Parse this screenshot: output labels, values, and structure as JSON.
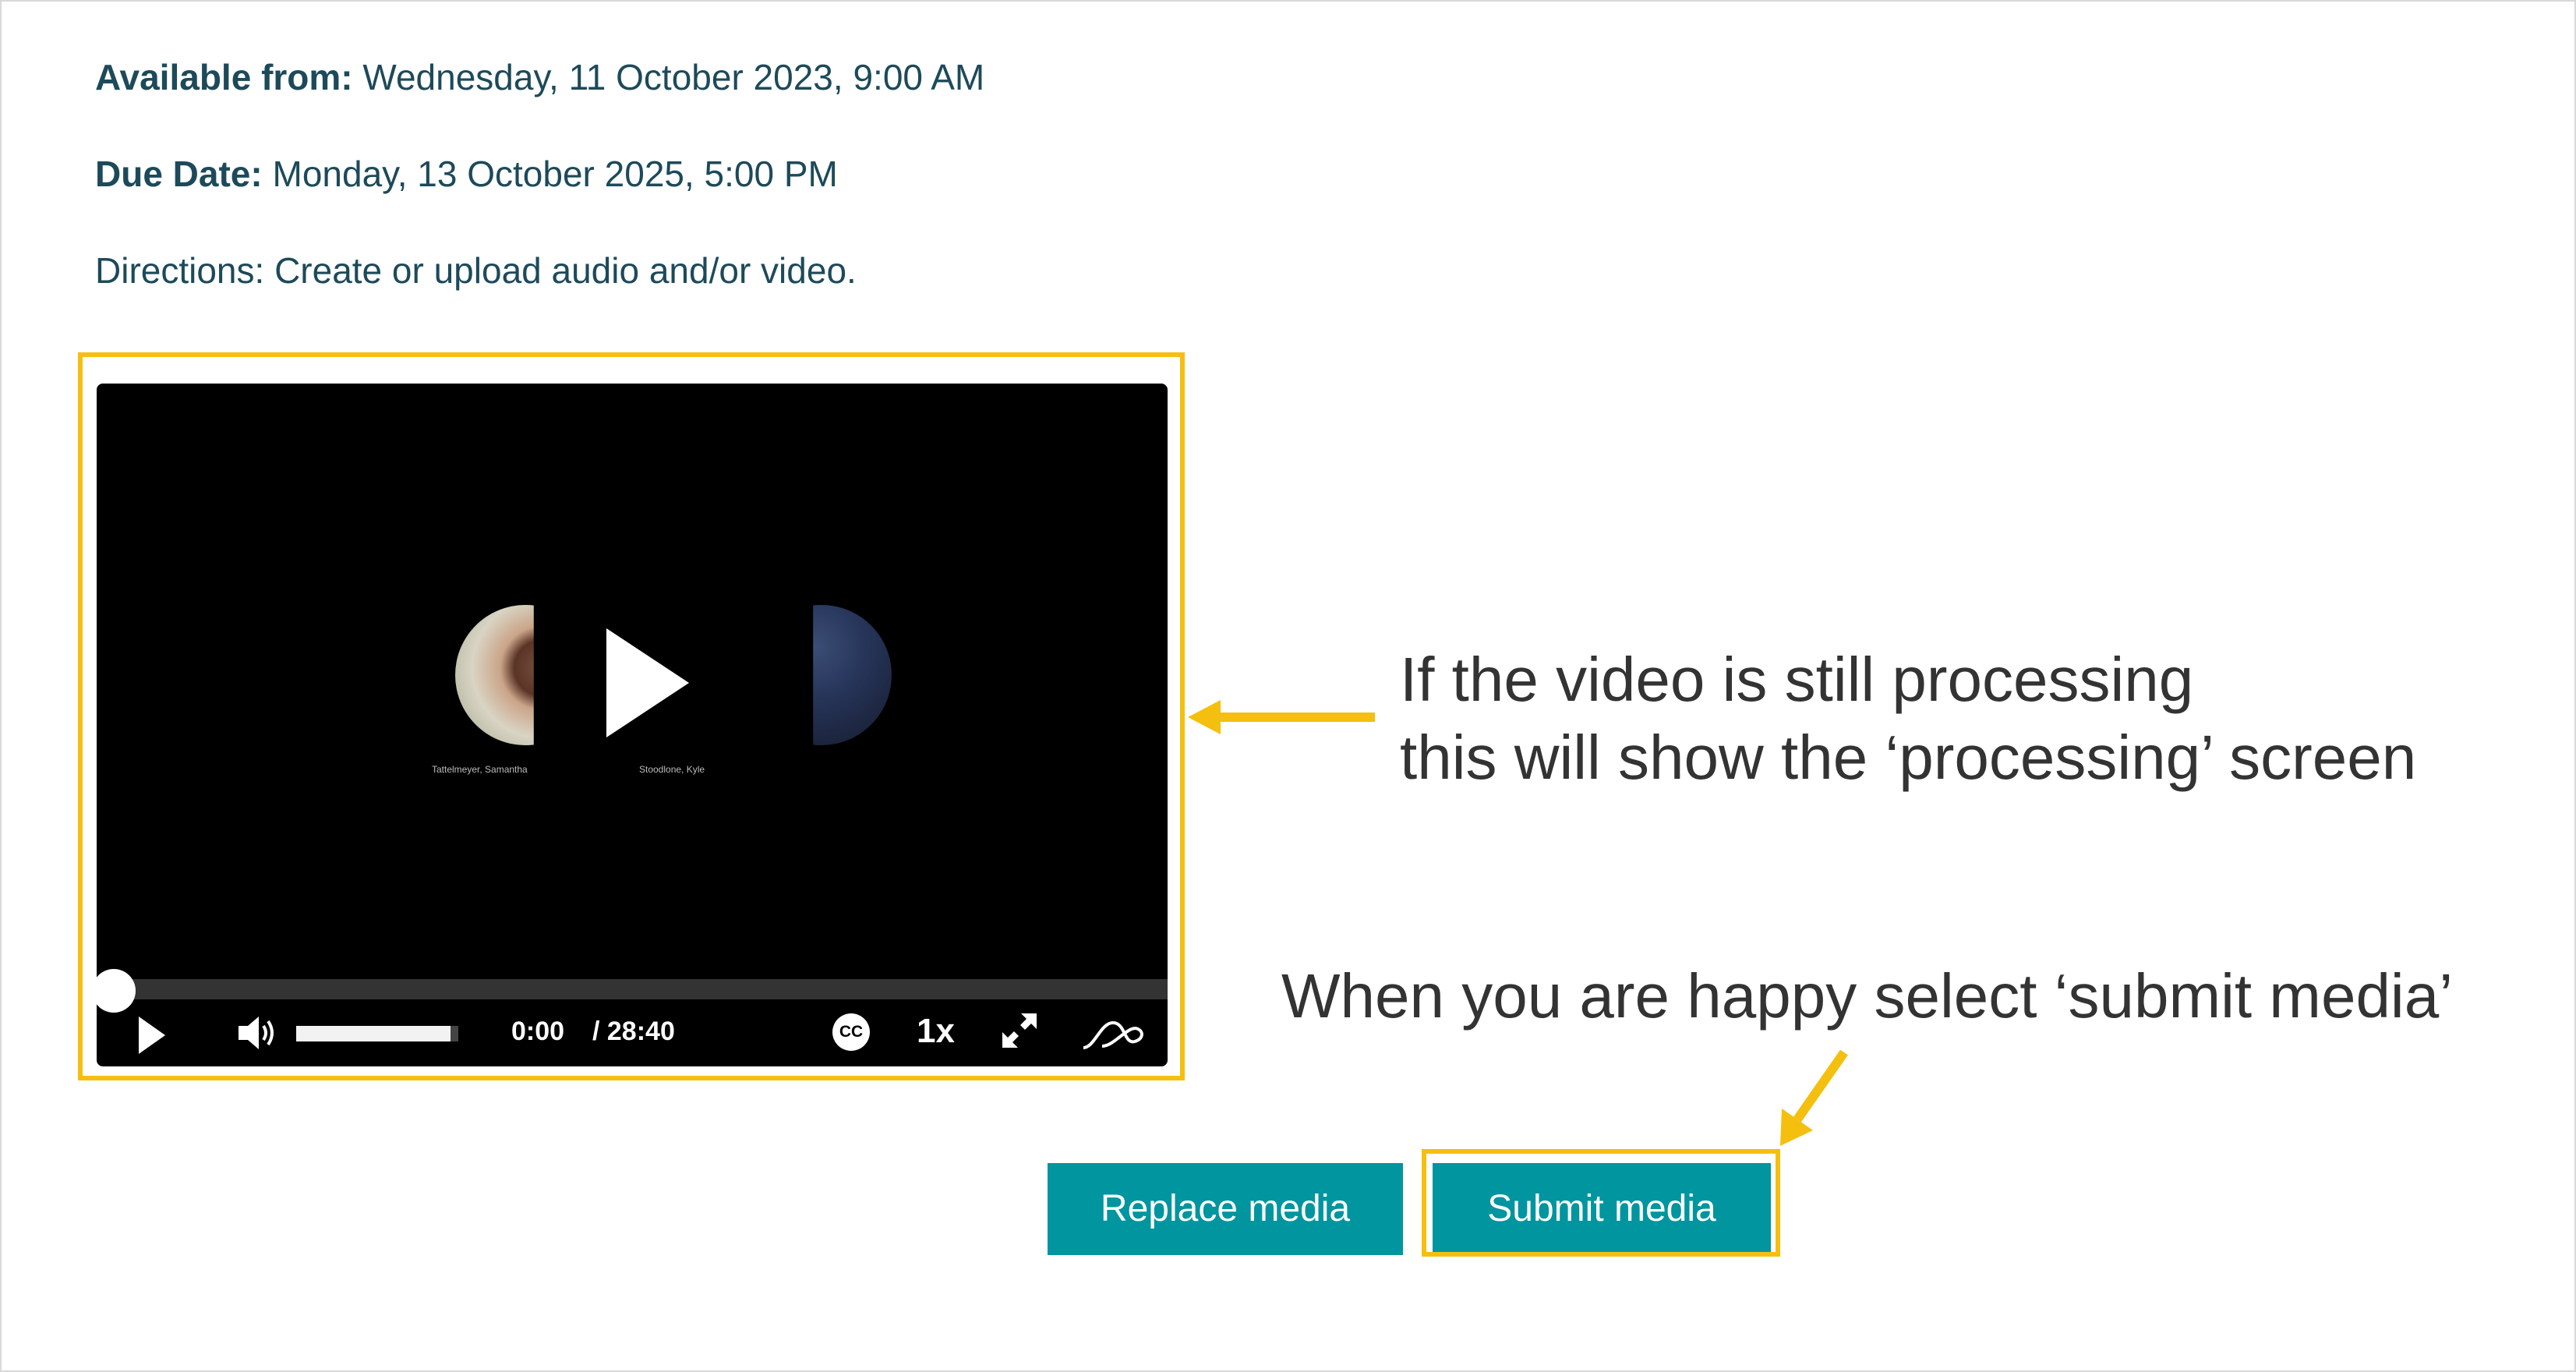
{
  "assignment": {
    "available_label": "Available from:",
    "available_value": " Wednesday, 11 October 2023, 9:00 AM",
    "due_label": "Due Date:",
    "due_value": " Monday, 13 October 2025, 5:00 PM",
    "directions": "Directions: Create or upload audio and/or video."
  },
  "player": {
    "participants": [
      "Tattelmeyer, Samantha",
      "Stoodlone, Kyle"
    ],
    "current_time": "0:00",
    "total_time": "/ 28:40",
    "progress": 0,
    "volume": 0.95,
    "cc_label": "CC",
    "speed": "1x",
    "icons": [
      "play-icon",
      "volume-icon",
      "closed-captions-icon",
      "fullscreen-icon",
      "player-logo-icon"
    ]
  },
  "actions": {
    "replace_label": "Replace media",
    "submit_label": "Submit media"
  },
  "annotations": {
    "processing_line1": "If the video is still processing",
    "processing_line2": "this will show the ‘processing’ screen",
    "submit_hint": "When you are happy select ‘submit media’"
  },
  "colors": {
    "highlight": "#f5bf0f",
    "button": "#00959f",
    "meta_text": "#1d4a5a",
    "annotation_text": "#333333"
  }
}
